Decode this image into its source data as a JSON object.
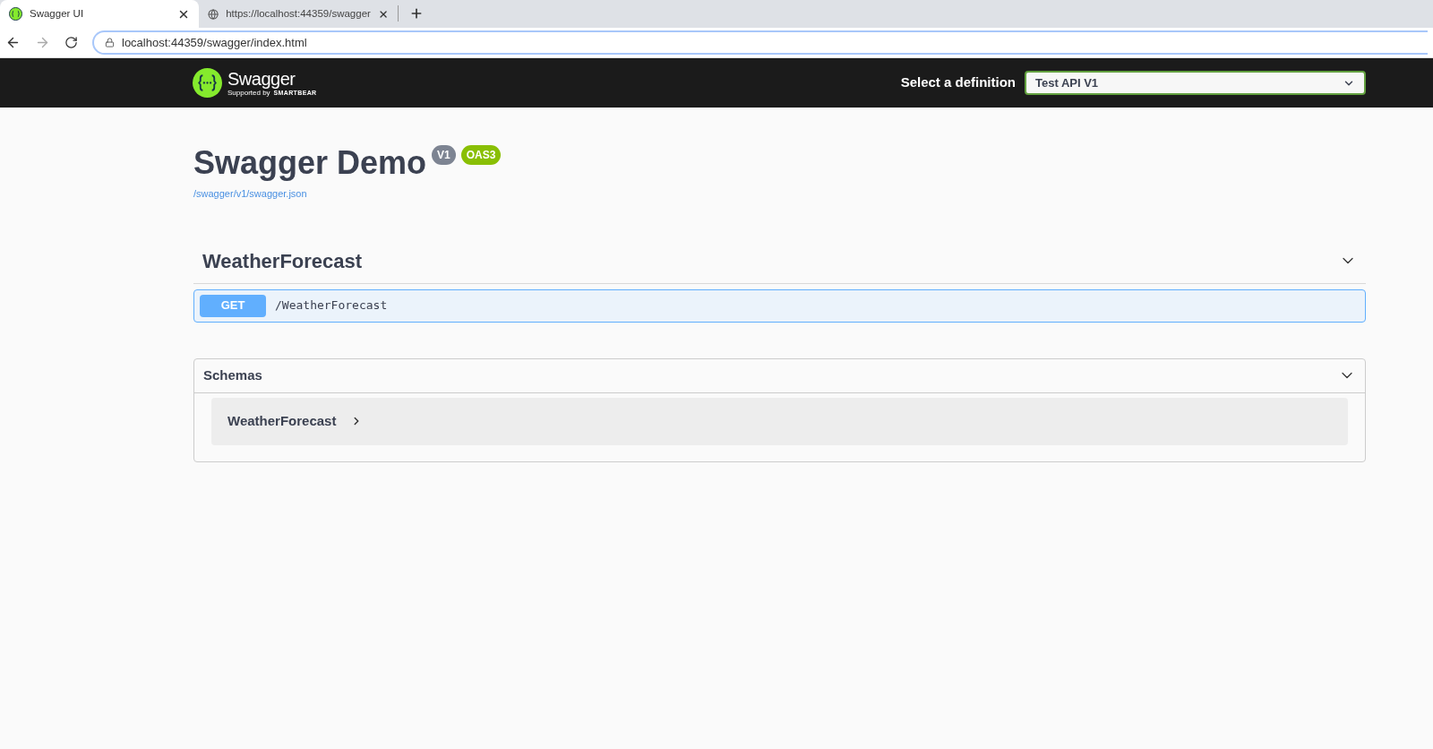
{
  "browser": {
    "tabs": [
      {
        "title": "Swagger UI",
        "selected": true
      },
      {
        "title": "https://localhost:44359/swagger",
        "selected": false
      }
    ],
    "address": "localhost:44359/swagger/index.html"
  },
  "topbar": {
    "logo_text": "Swagger",
    "logo_sub": "Supported by",
    "logo_brand": "SMARTBEAR",
    "definition_label": "Select a definition",
    "definition_value": "Test API V1"
  },
  "info": {
    "title": "Swagger Demo",
    "version": "V1",
    "oas": "OAS3",
    "spec_link": "/swagger/v1/swagger.json"
  },
  "tags": [
    {
      "name": "WeatherForecast",
      "expanded": true,
      "operations": [
        {
          "method": "GET",
          "path": "/WeatherForecast"
        }
      ]
    }
  ],
  "schemas": {
    "title": "Schemas",
    "expanded": true,
    "models": [
      {
        "name": "WeatherForecast",
        "expanded": false
      }
    ]
  }
}
